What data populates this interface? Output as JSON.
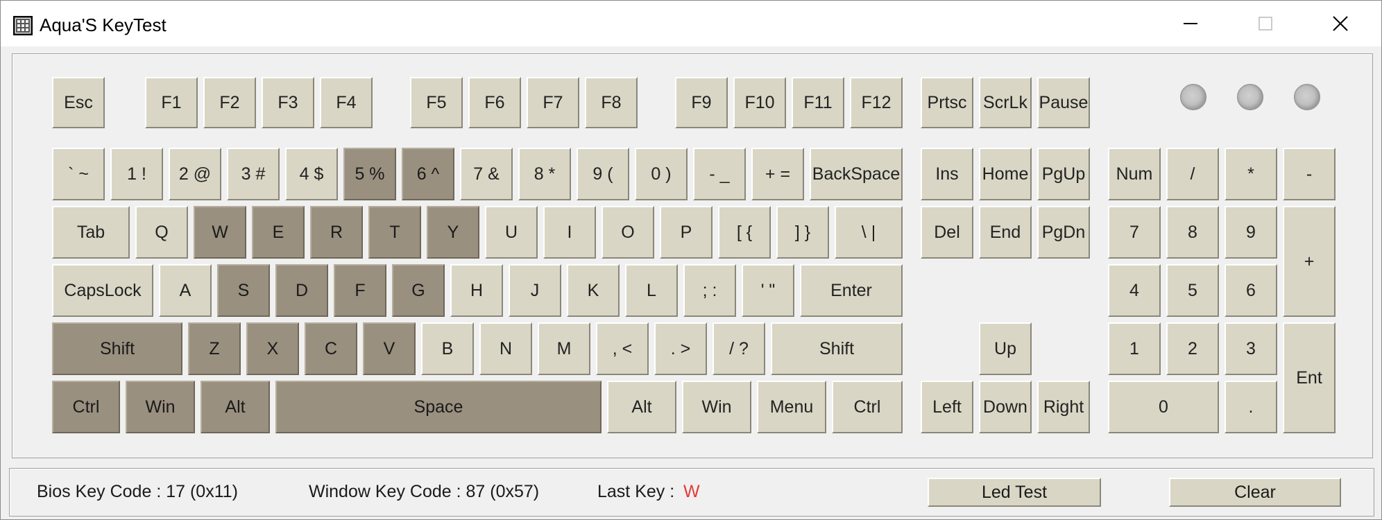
{
  "window": {
    "title": "Aqua'S KeyTest",
    "controls": {
      "minimize_icon": "minimize-icon",
      "maximize_icon": "maximize-icon",
      "close_icon": "close-icon"
    }
  },
  "keys": {
    "esc": "Esc",
    "f1": "F1",
    "f2": "F2",
    "f3": "F3",
    "f4": "F4",
    "f5": "F5",
    "f6": "F6",
    "f7": "F7",
    "f8": "F8",
    "f9": "F9",
    "f10": "F10",
    "f11": "F11",
    "f12": "F12",
    "prtsc": "Prtsc",
    "scrlk": "ScrLk",
    "pause": "Pause",
    "backtick": "` ~",
    "d1": "1 !",
    "d2": "2 @",
    "d3": "3 #",
    "d4": "4 $",
    "d5": "5 %",
    "d6": "6 ^",
    "d7": "7 &",
    "d8": "8 *",
    "d9": "9 (",
    "d0": "0 )",
    "minus": "- _",
    "equal": "+ =",
    "backspace": "BackSpace",
    "ins": "Ins",
    "home": "Home",
    "pgup": "PgUp",
    "num": "Num",
    "np_div": "/",
    "np_mul": "*",
    "np_sub": "-",
    "tab": "Tab",
    "q": "Q",
    "w": "W",
    "e": "E",
    "r": "R",
    "t": "T",
    "y": "Y",
    "u": "U",
    "i": "I",
    "o": "O",
    "p": "P",
    "lbracket": "[ {",
    "rbracket": "] }",
    "backslash": "\\ |",
    "del": "Del",
    "end": "End",
    "pgdn": "PgDn",
    "np7": "7",
    "np8": "8",
    "np9": "9",
    "np_add": "+",
    "capslock": "CapsLock",
    "a": "A",
    "s": "S",
    "d": "D",
    "f": "F",
    "g": "G",
    "h": "H",
    "j": "J",
    "k": "K",
    "l": "L",
    "semicolon": "; :",
    "quote": "' \"",
    "enter": "Enter",
    "np4": "4",
    "np5": "5",
    "np6": "6",
    "lshift": "Shift",
    "z": "Z",
    "x": "X",
    "c": "C",
    "v": "V",
    "b": "B",
    "n": "N",
    "m": "M",
    "comma": ", <",
    "period": ". >",
    "slash": "/ ?",
    "rshift": "Shift",
    "up": "Up",
    "np1": "1",
    "np2": "2",
    "np3": "3",
    "np_ent": "Ent",
    "lctrl": "Ctrl",
    "lwin": "Win",
    "lalt": "Alt",
    "space": "Space",
    "ralt": "Alt",
    "rwin": "Win",
    "menu": "Menu",
    "rctrl": "Ctrl",
    "left": "Left",
    "down": "Down",
    "right": "Right",
    "np0": "0",
    "np_dot": "."
  },
  "pressed_keys": [
    "d5",
    "d6",
    "w",
    "e",
    "r",
    "t",
    "y",
    "s",
    "d",
    "f",
    "g",
    "lshift",
    "z",
    "x",
    "c",
    "v",
    "lctrl",
    "lwin",
    "lalt",
    "space"
  ],
  "status": {
    "bios_key_code": "Bios Key Code : 17 (0x11)",
    "window_key_code": "Window Key Code : 87 (0x57)",
    "last_key_label": "Last Key :",
    "last_key_value": "W",
    "last_key_color": "#e23a3a",
    "led_test_button": "Led Test",
    "clear_button": "Clear"
  },
  "colors": {
    "key_face": "#d9d6c5",
    "key_pressed": "#9a9080",
    "background": "#f0f0f0"
  }
}
